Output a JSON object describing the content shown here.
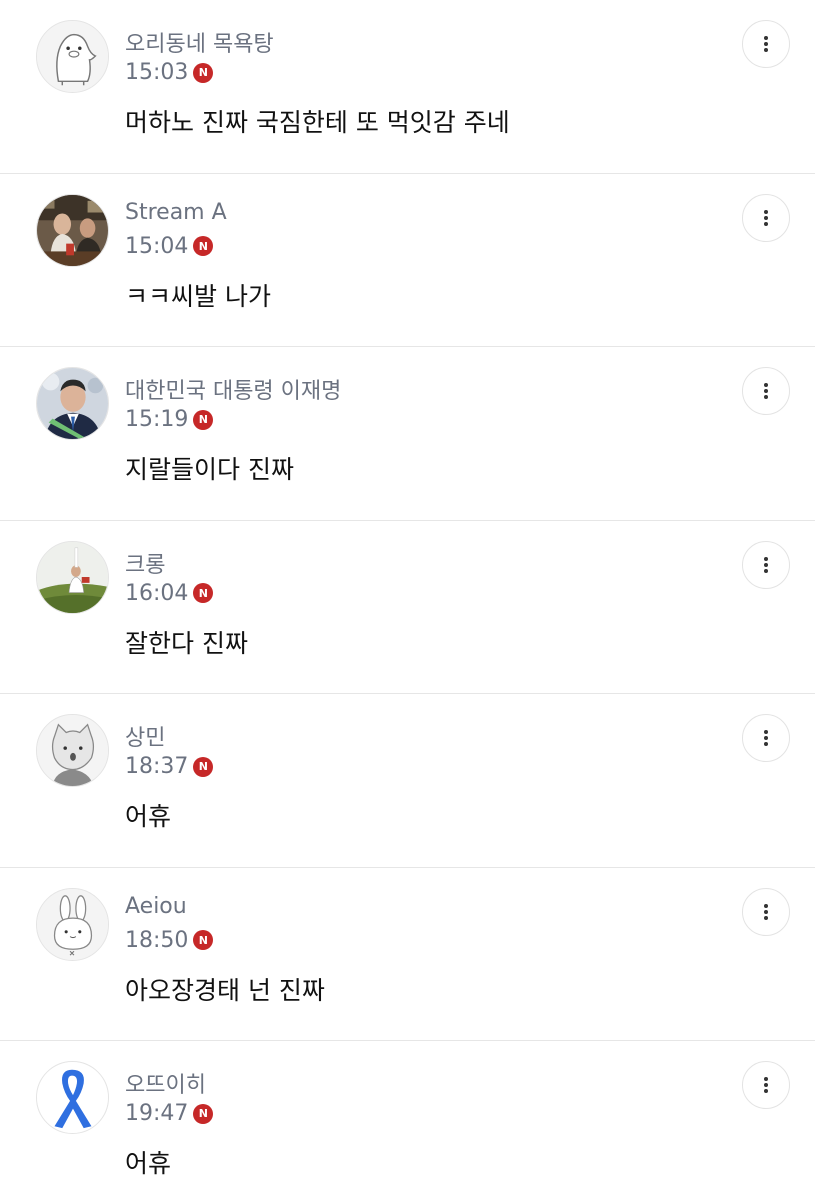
{
  "colors": {
    "badge": "#c62828",
    "author": "#6b7280",
    "text": "#111111",
    "divider": "#e6e6e6"
  },
  "comments": [
    {
      "author": "오리동네 목욕탕",
      "time": "15:03",
      "badge": "N",
      "text": "머하노 진짜 국짐한테 또 먹잇감 주네",
      "avatar": "duck-character-avatar"
    },
    {
      "author": "Stream A",
      "time": "15:04",
      "badge": "N",
      "text": "ㅋㅋ씨발 나가",
      "avatar": "photo-avatar"
    },
    {
      "author": "대한민국 대통령 이재명",
      "time": "15:19",
      "badge": "N",
      "text": "지랄들이다 진짜",
      "avatar": "person-photo-avatar"
    },
    {
      "author": "크롱",
      "time": "16:04",
      "badge": "N",
      "text": "잘한다 진짜",
      "avatar": "landscape-photo-avatar"
    },
    {
      "author": "상민",
      "time": "18:37",
      "badge": "N",
      "text": "어휴",
      "avatar": "cat-character-avatar"
    },
    {
      "author": "Aeiou",
      "time": "18:50",
      "badge": "N",
      "text": "아오장경태 넌 진짜",
      "avatar": "rabbit-character-avatar"
    },
    {
      "author": "오뜨이히",
      "time": "19:47",
      "badge": "N",
      "text": "어휴",
      "avatar": "blue-ribbon-avatar"
    }
  ]
}
